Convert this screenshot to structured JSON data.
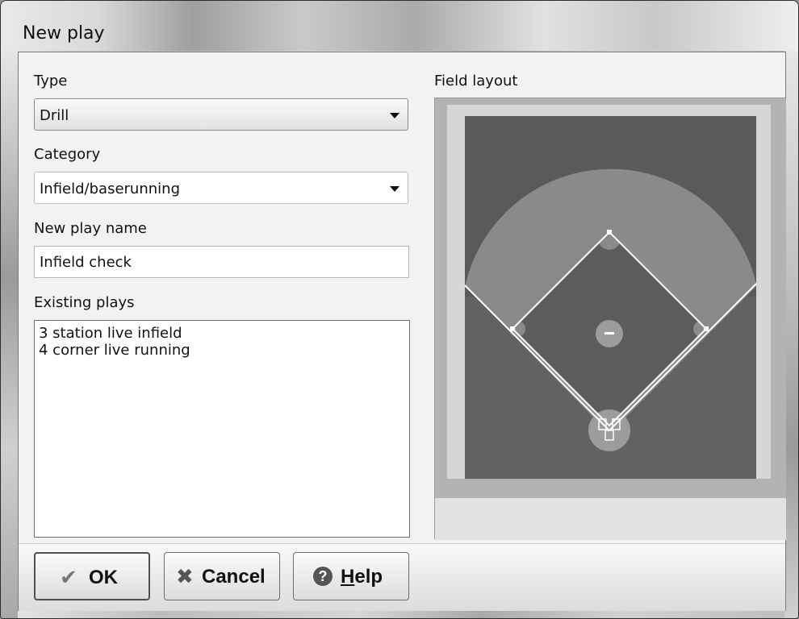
{
  "window": {
    "title": "New play"
  },
  "form": {
    "type_label": "Type",
    "type_value": "Drill",
    "category_label": "Category",
    "category_value": "Infield/baserunning",
    "name_label": "New play name",
    "name_value": "Infield check",
    "existing_label": "Existing plays",
    "existing_plays": [
      "3 station live infield",
      "4 corner live running"
    ]
  },
  "field": {
    "label": "Field layout",
    "nav": {
      "first": "≪",
      "prev": "<",
      "next": ">",
      "last": "≫"
    }
  },
  "buttons": {
    "ok": "OK",
    "cancel": "Cancel",
    "help_prefix": "H",
    "help_rest": "elp"
  },
  "icons": {
    "ok": "check-icon",
    "cancel": "x-icon",
    "help": "question-icon",
    "dropdown": "triangle-down-icon"
  }
}
